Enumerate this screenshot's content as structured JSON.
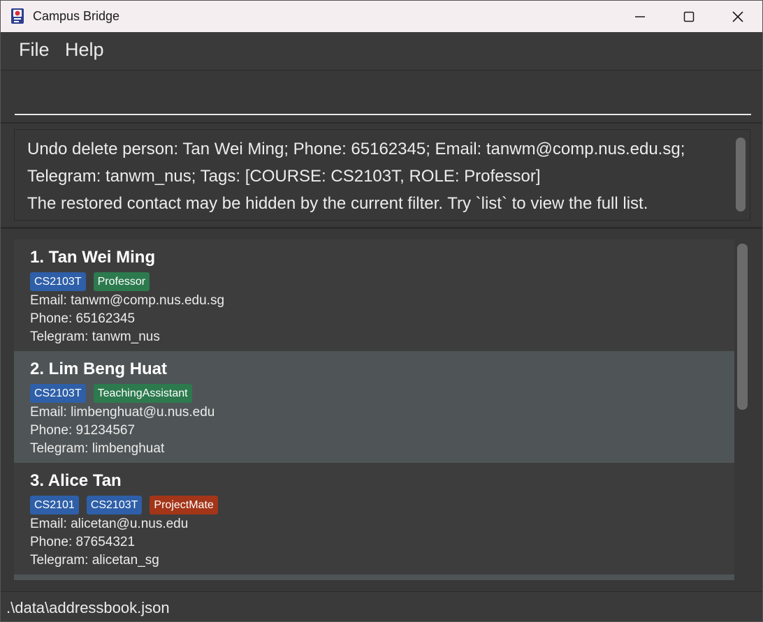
{
  "window": {
    "title": "Campus Bridge",
    "icon": "campus-bridge-app-icon"
  },
  "menu": {
    "items": [
      {
        "label": "File"
      },
      {
        "label": "Help"
      }
    ]
  },
  "command": {
    "value": "",
    "placeholder": ""
  },
  "result": {
    "lines": [
      "Undo delete person: Tan Wei Ming; Phone: 65162345; Email: tanwm@comp.nus.edu.sg;",
      "Telegram: tanwm_nus; Tags: [COURSE: CS2103T, ROLE: Professor]",
      "The restored contact may be hidden by the current filter. Try `list` to view the full list."
    ]
  },
  "persons": [
    {
      "name": "1. Tan Wei Ming",
      "tags": [
        {
          "label": "CS2103T",
          "kind": "course"
        },
        {
          "label": "Professor",
          "kind": "role"
        }
      ],
      "email": "Email: tanwm@comp.nus.edu.sg",
      "phone": "Phone: 65162345",
      "telegram": "Telegram: tanwm_nus",
      "selected": false
    },
    {
      "name": "2. Lim Beng Huat",
      "tags": [
        {
          "label": "CS2103T",
          "kind": "course"
        },
        {
          "label": "TeachingAssistant",
          "kind": "role"
        }
      ],
      "email": "Email: limbenghuat@u.nus.edu",
      "phone": "Phone: 91234567",
      "telegram": "Telegram: limbenghuat",
      "selected": true
    },
    {
      "name": "3. Alice Tan",
      "tags": [
        {
          "label": "CS2101",
          "kind": "course"
        },
        {
          "label": "CS2103T",
          "kind": "course"
        },
        {
          "label": "ProjectMate",
          "kind": "project"
        }
      ],
      "email": "Email: alicetan@u.nus.edu",
      "phone": "Phone: 87654321",
      "telegram": "Telegram: alicetan_sg",
      "selected": false
    }
  ],
  "status": {
    "path": ".\\data\\addressbook.json"
  },
  "colors": {
    "background": "#383838",
    "titlebar": "#f5eef0",
    "card": "#3d3d3d",
    "card_selected": "#4f5556",
    "tag_course": "#2e5fa8",
    "tag_role": "#2c7a4e",
    "tag_project": "#a33518"
  }
}
